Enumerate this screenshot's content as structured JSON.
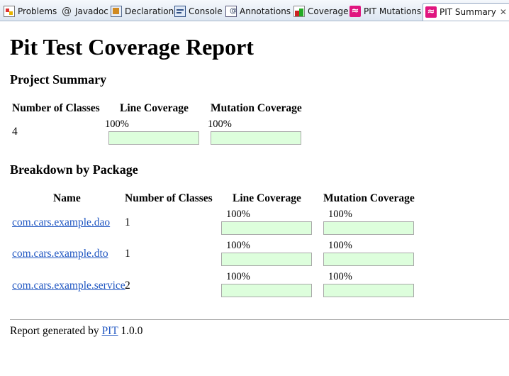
{
  "tabs": [
    {
      "label": "Problems",
      "icon": "problems-icon"
    },
    {
      "label": "Javadoc",
      "icon": "at-icon"
    },
    {
      "label": "Declaration",
      "icon": "declaration-icon"
    },
    {
      "label": "Console",
      "icon": "console-icon"
    },
    {
      "label": "Annotations",
      "icon": "annotations-icon"
    },
    {
      "label": "Coverage",
      "icon": "coverage-icon"
    },
    {
      "label": "PIT Mutations",
      "icon": "pit-icon"
    },
    {
      "label": "PIT Summary",
      "icon": "pit-icon",
      "active": true
    }
  ],
  "report": {
    "title": "Pit Test Coverage Report",
    "project_summary": {
      "heading": "Project Summary",
      "columns": [
        "Number of Classes",
        "Line Coverage",
        "Mutation Coverage"
      ],
      "number_of_classes": "4",
      "line_coverage": "100%",
      "mutation_coverage": "100%"
    },
    "breakdown": {
      "heading": "Breakdown by Package",
      "columns": [
        "Name",
        "Number of Classes",
        "Line Coverage",
        "Mutation Coverage"
      ],
      "rows": [
        {
          "name": "com.cars.example.dao",
          "classes": "1",
          "line": "100%",
          "mutation": "100%"
        },
        {
          "name": "com.cars.example.dto",
          "classes": "1",
          "line": "100%",
          "mutation": "100%"
        },
        {
          "name": "com.cars.example.service",
          "classes": "2",
          "line": "100%",
          "mutation": "100%"
        }
      ]
    },
    "footer": {
      "prefix": "Report generated by",
      "link": "PIT",
      "version": "1.0.0"
    }
  },
  "colors": {
    "coverage_bar": "#ddfedc",
    "link": "#2157c2",
    "pit_icon": "#e0157f"
  }
}
